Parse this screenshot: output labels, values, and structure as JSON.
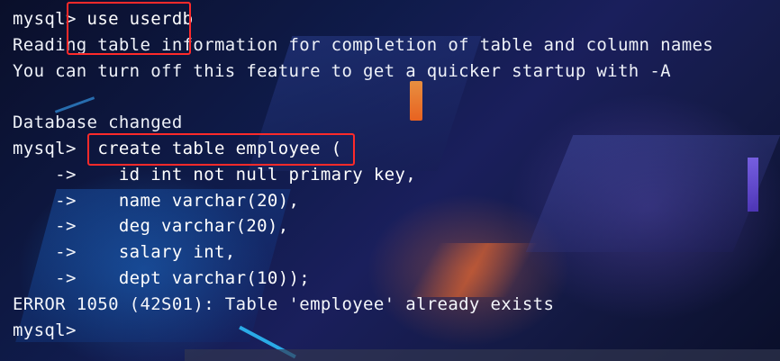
{
  "terminal": {
    "lines": [
      {
        "prompt": "mysql> ",
        "text": "use userdb"
      },
      {
        "text": "Reading table information for completion of table and column names"
      },
      {
        "text": "You can turn off this feature to get a quicker startup with -A"
      },
      {
        "text": ""
      },
      {
        "text": "Database changed"
      },
      {
        "prompt": "mysql>  ",
        "text": "create table employee ("
      },
      {
        "prompt": "    ->    ",
        "text": "id int not null primary key,"
      },
      {
        "prompt": "    ->    ",
        "text": "name varchar(20),"
      },
      {
        "prompt": "    ->    ",
        "text": "deg varchar(20),"
      },
      {
        "prompt": "    ->    ",
        "text": "salary int,"
      },
      {
        "prompt": "    ->    ",
        "text": "dept varchar(10));"
      },
      {
        "text": "ERROR 1050 (42S01): Table 'employee' already exists"
      },
      {
        "prompt": "mysql> ",
        "text": ""
      }
    ]
  },
  "annotations": {
    "highlight_color": "#ff2a2a"
  },
  "colors": {
    "text": "#f4f6fb",
    "background": "#0f1b4a"
  }
}
